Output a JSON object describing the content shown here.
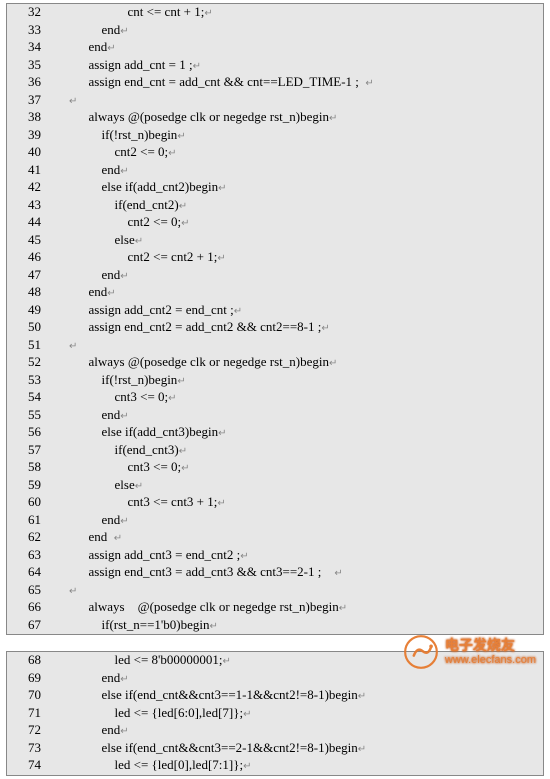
{
  "panels": [
    {
      "lines": [
        {
          "n": "32",
          "indent": 20,
          "text": "cnt <= cnt + 1;"
        },
        {
          "n": "33",
          "indent": 12,
          "text": "end"
        },
        {
          "n": "34",
          "indent": 8,
          "text": "end"
        },
        {
          "n": "35",
          "indent": 8,
          "text": "assign add_cnt = 1 ;"
        },
        {
          "n": "36",
          "indent": 8,
          "text": "assign end_cnt = add_cnt && cnt==LED_TIME-1 ;  "
        },
        {
          "n": "37",
          "indent": 0,
          "text": "  "
        },
        {
          "n": "38",
          "indent": 8,
          "text": "always @(posedge clk or negedge rst_n)begin"
        },
        {
          "n": "39",
          "indent": 12,
          "text": "if(!rst_n)begin"
        },
        {
          "n": "40",
          "indent": 16,
          "text": "cnt2 <= 0;"
        },
        {
          "n": "41",
          "indent": 12,
          "text": "end"
        },
        {
          "n": "42",
          "indent": 12,
          "text": "else if(add_cnt2)begin"
        },
        {
          "n": "43",
          "indent": 16,
          "text": "if(end_cnt2)"
        },
        {
          "n": "44",
          "indent": 20,
          "text": "cnt2 <= 0;"
        },
        {
          "n": "45",
          "indent": 16,
          "text": "else"
        },
        {
          "n": "46",
          "indent": 20,
          "text": "cnt2 <= cnt2 + 1;"
        },
        {
          "n": "47",
          "indent": 12,
          "text": "end"
        },
        {
          "n": "48",
          "indent": 8,
          "text": "end"
        },
        {
          "n": "49",
          "indent": 8,
          "text": "assign add_cnt2 = end_cnt ;"
        },
        {
          "n": "50",
          "indent": 8,
          "text": "assign end_cnt2 = add_cnt2 && cnt2==8-1 ;"
        },
        {
          "n": "51",
          "indent": 0,
          "text": "  "
        },
        {
          "n": "52",
          "indent": 8,
          "text": "always @(posedge clk or negedge rst_n)begin"
        },
        {
          "n": "53",
          "indent": 12,
          "text": "if(!rst_n)begin"
        },
        {
          "n": "54",
          "indent": 16,
          "text": "cnt3 <= 0;"
        },
        {
          "n": "55",
          "indent": 12,
          "text": "end"
        },
        {
          "n": "56",
          "indent": 12,
          "text": "else if(add_cnt3)begin"
        },
        {
          "n": "57",
          "indent": 16,
          "text": "if(end_cnt3)"
        },
        {
          "n": "58",
          "indent": 20,
          "text": "cnt3 <= 0;"
        },
        {
          "n": "59",
          "indent": 16,
          "text": "else"
        },
        {
          "n": "60",
          "indent": 20,
          "text": "cnt3 <= cnt3 + 1;"
        },
        {
          "n": "61",
          "indent": 12,
          "text": "end"
        },
        {
          "n": "62",
          "indent": 8,
          "text": "end  "
        },
        {
          "n": "63",
          "indent": 8,
          "text": "assign add_cnt3 = end_cnt2 ;"
        },
        {
          "n": "64",
          "indent": 8,
          "text": "assign end_cnt3 = add_cnt3 && cnt3==2-1 ;    "
        },
        {
          "n": "65",
          "indent": 0,
          "text": "  "
        },
        {
          "n": "66",
          "indent": 8,
          "text": "always    @(posedge clk or negedge rst_n)begin"
        },
        {
          "n": "67",
          "indent": 12,
          "text": "if(rst_n==1'b0)begin"
        }
      ]
    },
    {
      "lines": [
        {
          "n": "68",
          "indent": 16,
          "text": "led <= 8'b00000001;"
        },
        {
          "n": "69",
          "indent": 12,
          "text": "end"
        },
        {
          "n": "70",
          "indent": 12,
          "text": "else if(end_cnt&&cnt3==1-1&&cnt2!=8-1)begin"
        },
        {
          "n": "71",
          "indent": 16,
          "text": "led <= {led[6:0],led[7]};"
        },
        {
          "n": "72",
          "indent": 12,
          "text": "end"
        },
        {
          "n": "73",
          "indent": 12,
          "text": "else if(end_cnt&&cnt3==2-1&&cnt2!=8-1)begin"
        },
        {
          "n": "74",
          "indent": 16,
          "text": "led <= {led[0],led[7:1]};"
        }
      ]
    }
  ],
  "watermark": {
    "cn": "电子发烧友",
    "url": "www.elecfans.com"
  }
}
